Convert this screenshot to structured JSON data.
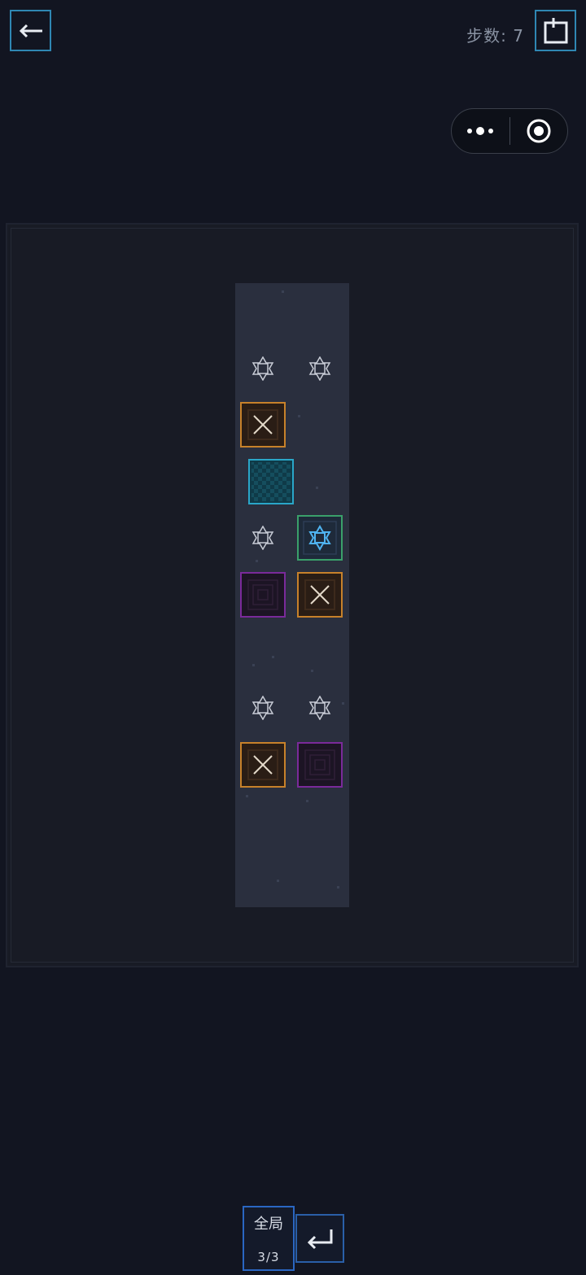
{
  "header": {
    "steps_label": "步数:",
    "steps_value": "7",
    "back_icon": "arrow-left-icon",
    "share_icon": "share-icon"
  },
  "capsule": {
    "more_icon": "more-dots-icon",
    "close_icon": "target-circle-icon"
  },
  "board": {
    "cells": [
      {
        "type": "goal-marker"
      },
      {
        "type": "goal-marker"
      },
      {
        "type": "crate"
      },
      {
        "type": "player"
      },
      {
        "type": "goal-marker"
      },
      {
        "type": "crate-on-goal"
      },
      {
        "type": "portal"
      },
      {
        "type": "crate"
      },
      {
        "type": "goal-marker"
      },
      {
        "type": "goal-marker"
      },
      {
        "type": "crate"
      },
      {
        "type": "portal"
      }
    ],
    "colors": {
      "crate": "#c7812a",
      "portal": "#7a2a9a",
      "player": "#2aa6c8",
      "goal_active": "#3aa06a"
    }
  },
  "footer": {
    "overview_label": "全局",
    "level_progress": "3/3",
    "undo_icon": "enter-return-icon"
  }
}
